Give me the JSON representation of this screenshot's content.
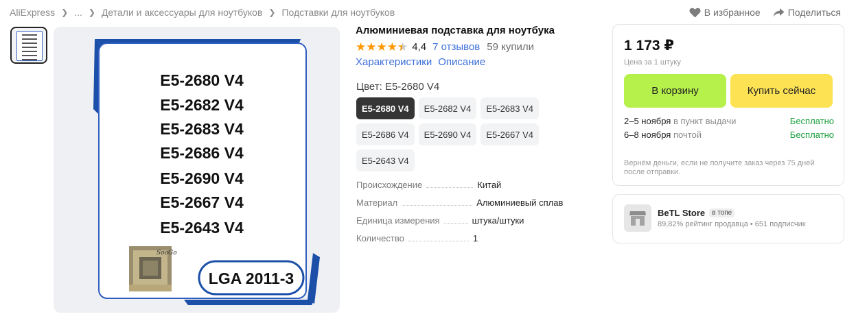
{
  "breadcrumb": {
    "items": [
      "AliExpress",
      "...",
      "Детали и аксессуары для ноутбуков",
      "Подставки для ноутбуков"
    ]
  },
  "top_actions": {
    "favorite_label": "В избранное",
    "share_label": "Поделиться"
  },
  "product_image": {
    "lines": [
      "E5-2680 V4",
      "E5-2682 V4",
      "E5-2683 V4",
      "E5-2686 V4",
      "E5-2690 V4",
      "E5-2667 V4",
      "E5-2643 V4"
    ],
    "socket_label": "LGA 2011-3",
    "watermark": "SooGo",
    "frame_color": "#2f5fc0",
    "accent_color": "#1b4fa8"
  },
  "product": {
    "title": "Алюминиевая подставка для ноутбука",
    "rating": "4,4",
    "rating_value": 4.4,
    "reviews": "7 отзывов",
    "sold": "59 купили",
    "tab_characteristics": "Характеристики",
    "tab_description": "Описание",
    "color_label": "Цвет: E5-2680 V4",
    "variants": [
      {
        "label": "E5-2680 V4",
        "active": true
      },
      {
        "label": "E5-2682 V4",
        "active": false
      },
      {
        "label": "E5-2683 V4",
        "active": false
      },
      {
        "label": "E5-2686 V4",
        "active": false
      },
      {
        "label": "E5-2690 V4",
        "active": false
      },
      {
        "label": "E5-2667 V4",
        "active": false
      },
      {
        "label": "E5-2643 V4",
        "active": false
      }
    ],
    "specs": [
      {
        "key": "Происхождение",
        "value": "Китай"
      },
      {
        "key": "Материал",
        "value": "Алюминиевый сплав"
      },
      {
        "key": "Единица измерения",
        "value": "штука/штуки"
      },
      {
        "key": "Количество",
        "value": "1"
      }
    ]
  },
  "buybox": {
    "price": "1 173 ₽",
    "price_note": "Цена за 1 штуку",
    "cart_label": "В корзину",
    "buy_now_label": "Купить сейчас",
    "shipping": [
      {
        "when": "2–5 ноября",
        "how": "в пункт выдачи",
        "cost": "Бесплатно"
      },
      {
        "when": "6–8 ноября",
        "how": "почтой",
        "cost": "Бесплатно"
      }
    ],
    "refund_note": "Вернём деньги, если не получите заказ через 75 дней после отправки.",
    "colors": {
      "cart": "#b6f04a",
      "buy": "#fde254",
      "free": "#1a9e3c"
    }
  },
  "store": {
    "name": "BeTL Store",
    "badge": "в топе",
    "meta": "89,82% рейтинг продавца • 651 подписчик"
  },
  "colors": {
    "link": "#3d6fd9",
    "star": "#ff9700"
  }
}
